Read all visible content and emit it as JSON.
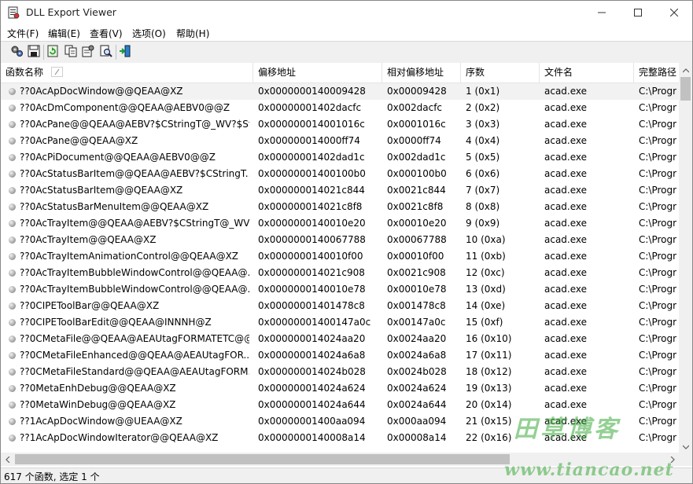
{
  "window": {
    "title": "DLL Export Viewer"
  },
  "menu": [
    "文件(F)",
    "编辑(E)",
    "查看(V)",
    "选项(O)",
    "帮助(H)"
  ],
  "toolbar": {
    "buttons": [
      "properties-icon",
      "save-icon",
      "refresh-icon",
      "copy-icon",
      "html-report-icon",
      "find-icon",
      "exit-icon"
    ]
  },
  "columns": [
    "函数名称",
    "偏移地址",
    "相对偏移地址",
    "序数",
    "文件名",
    "完整路径"
  ],
  "rows": [
    [
      "??0AcApDocWindow@@QEAA@XZ",
      "0x0000000140009428",
      "0x00009428",
      "1 (0x1)",
      "acad.exe",
      "C:\\Progra"
    ],
    [
      "??0AcDmComponent@@QEAA@AEBV0@@Z",
      "0x00000001402dacfc",
      "0x002dacfc",
      "2 (0x2)",
      "acad.exe",
      "C:\\Progra"
    ],
    [
      "??0AcPane@@QEAA@AEBV?$CStringT@_WV?$St...",
      "0x000000014001016c",
      "0x0001016c",
      "3 (0x3)",
      "acad.exe",
      "C:\\Progra"
    ],
    [
      "??0AcPane@@QEAA@XZ",
      "0x000000014000ff74",
      "0x0000ff74",
      "4 (0x4)",
      "acad.exe",
      "C:\\Progra"
    ],
    [
      "??0AcPiDocument@@QEAA@AEBV0@@Z",
      "0x00000001402dad1c",
      "0x002dad1c",
      "5 (0x5)",
      "acad.exe",
      "C:\\Progra"
    ],
    [
      "??0AcStatusBarItem@@QEAA@AEBV?$CStringT...",
      "0x00000001400100b0",
      "0x000100b0",
      "6 (0x6)",
      "acad.exe",
      "C:\\Progra"
    ],
    [
      "??0AcStatusBarItem@@QEAA@XZ",
      "0x000000014021c844",
      "0x0021c844",
      "7 (0x7)",
      "acad.exe",
      "C:\\Progra"
    ],
    [
      "??0AcStatusBarMenuItem@@QEAA@XZ",
      "0x000000014021c8f8",
      "0x0021c8f8",
      "8 (0x8)",
      "acad.exe",
      "C:\\Progra"
    ],
    [
      "??0AcTrayItem@@QEAA@AEBV?$CStringT@_WV...",
      "0x0000000140010e20",
      "0x00010e20",
      "9 (0x9)",
      "acad.exe",
      "C:\\Progra"
    ],
    [
      "??0AcTrayItem@@QEAA@XZ",
      "0x0000000140067788",
      "0x00067788",
      "10 (0xa)",
      "acad.exe",
      "C:\\Progra"
    ],
    [
      "??0AcTrayItemAnimationControl@@QEAA@XZ",
      "0x0000000140010f00",
      "0x00010f00",
      "11 (0xb)",
      "acad.exe",
      "C:\\Progra"
    ],
    [
      "??0AcTrayItemBubbleWindowControl@@QEAA@...",
      "0x000000014021c908",
      "0x0021c908",
      "12 (0xc)",
      "acad.exe",
      "C:\\Progra"
    ],
    [
      "??0AcTrayItemBubbleWindowControl@@QEAA@...",
      "0x0000000140010e78",
      "0x00010e78",
      "13 (0xd)",
      "acad.exe",
      "C:\\Progra"
    ],
    [
      "??0CIPEToolBar@@QEAA@XZ",
      "0x00000001401478c8",
      "0x001478c8",
      "14 (0xe)",
      "acad.exe",
      "C:\\Progra"
    ],
    [
      "??0CIPEToolBarEdit@@QEAA@INNNH@Z",
      "0x00000001400147a0c",
      "0x00147a0c",
      "15 (0xf)",
      "acad.exe",
      "C:\\Progra"
    ],
    [
      "??0CMetaFile@@QEAA@AEAUtagFORMATETC@@...",
      "0x000000014024aa20",
      "0x0024aa20",
      "16 (0x10)",
      "acad.exe",
      "C:\\Progra"
    ],
    [
      "??0CMetaFileEnhanced@@QEAA@AEAUtagFOR...",
      "0x000000014024a6a8",
      "0x0024a6a8",
      "17 (0x11)",
      "acad.exe",
      "C:\\Progra"
    ],
    [
      "??0CMetaFileStandard@@QEAA@AEAUtagFORM...",
      "0x000000014024b028",
      "0x0024b028",
      "18 (0x12)",
      "acad.exe",
      "C:\\Progra"
    ],
    [
      "??0MetaEnhDebug@@QEAA@XZ",
      "0x000000014024a624",
      "0x0024a624",
      "19 (0x13)",
      "acad.exe",
      "C:\\Progra"
    ],
    [
      "??0MetaWinDebug@@QEAA@XZ",
      "0x000000014024a644",
      "0x0024a644",
      "20 (0x14)",
      "acad.exe",
      "C:\\Progra"
    ],
    [
      "??1AcApDocWindow@@UEAA@XZ",
      "0x00000001400aa094",
      "0x000aa094",
      "21 (0x15)",
      "acad.exe",
      "C:\\Progra"
    ],
    [
      "??1AcApDocWindowIterator@@QEAA@XZ",
      "0x0000000140008a14",
      "0x00008a14",
      "22 (0x16)",
      "acad.exe",
      "C:\\Progra"
    ]
  ],
  "status": "617 个函数, 选定 1 个",
  "watermark": {
    "title": "田草博客",
    "url": "www.tiancao.net"
  }
}
